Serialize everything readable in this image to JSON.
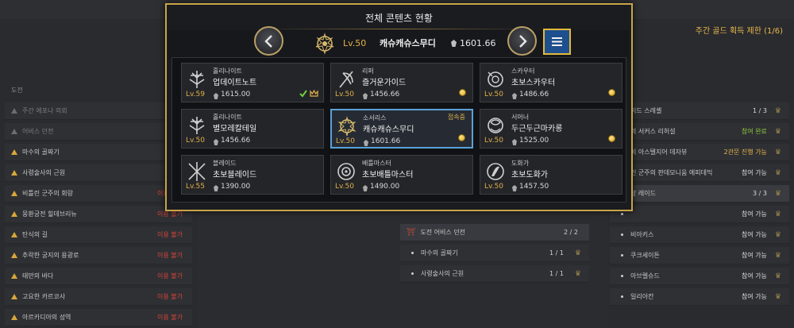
{
  "background": {
    "gold_limit": "주간 골드 획득 제한 (1/6)",
    "left_header": "도전",
    "left_rows": [
      {
        "name": "주간 에포나 의뢰",
        "status": ""
      },
      {
        "name": "어비스 던전",
        "status": ""
      },
      {
        "name": "마수의 골짜기",
        "status": "이용"
      },
      {
        "name": "사령술사의 근원",
        "status": "이용"
      },
      {
        "name": "비틀린 군주의 회랑",
        "status": "이용 불가"
      },
      {
        "name": "몽환궁전 힐데브리뉴",
        "status": "이용 불가"
      },
      {
        "name": "탄식의 길",
        "status": "이용 불가"
      },
      {
        "name": "추락한 궁지의 용광로",
        "status": "이용 불가"
      },
      {
        "name": "태만의 바다",
        "status": "이용 불가"
      },
      {
        "name": "고요한 카르코사",
        "status": "이용 불가"
      },
      {
        "name": "아르카디아의 성역",
        "status": "이용 불가"
      }
    ],
    "mid_rows": [
      {
        "name": "도전 어비스 던전",
        "count": "2 / 2"
      },
      {
        "name": "마수의 골짜기",
        "count": "1 / 1"
      },
      {
        "name": "사령술사의 근원",
        "count": "1 / 1"
      }
    ],
    "right_rows": [
      {
        "name": "이드 스레셸",
        "status": "1 / 3",
        "tone": "wht"
      },
      {
        "name": "의 서커스 리허설",
        "status": "참여 완료",
        "tone": "grn"
      },
      {
        "name": "비 아스텔지어 데자뷰",
        "status": "2관문 진행 가능",
        "tone": "yel"
      },
      {
        "name": "린 군주의 판데모니움 에피데믹",
        "status": "참여 가능",
        "tone": "wht"
      },
      {
        "name": "장 레이드",
        "status": "3 / 3",
        "tone": "wht"
      },
      {
        "name": "",
        "status": "참여 가능",
        "tone": "wht"
      },
      {
        "name": "비아키스",
        "status": "참여 가능",
        "tone": "wht"
      },
      {
        "name": "쿠크세이튼",
        "status": "참여 가능",
        "tone": "wht"
      },
      {
        "name": "아브렐슈드",
        "status": "참여 가능",
        "tone": "wht"
      },
      {
        "name": "일리아칸",
        "status": "참여 가능",
        "tone": "wht"
      }
    ]
  },
  "modal": {
    "title": "전체 콘텐츠 현황",
    "selected": {
      "level": "Lv.50",
      "name": "캐슈캐슈스무디",
      "item_level": "1601.66",
      "icon": "sorceress-emblem-icon"
    },
    "prev_icon": "chevron-left-icon",
    "next_icon": "chevron-right-icon",
    "menu_icon": "menu-icon",
    "characters": [
      {
        "class": "홀리나이트",
        "name": "업데이트노트",
        "level": "Lv.59",
        "item_level": "1615.00",
        "status": "",
        "icon": "holy-knight-emblem-icon",
        "marks": [
          "check",
          "crown"
        ]
      },
      {
        "class": "리퍼",
        "name": "즐거운가이드",
        "level": "Lv.50",
        "item_level": "1456.66",
        "status": "",
        "icon": "reaper-emblem-icon",
        "marks": [
          "coin"
        ]
      },
      {
        "class": "스카우터",
        "name": "초보스카우터",
        "level": "Lv.50",
        "item_level": "1486.66",
        "status": "",
        "icon": "scouter-emblem-icon",
        "marks": [
          "coin"
        ]
      },
      {
        "class": "홀리나이트",
        "name": "별모레칼테일",
        "level": "Lv.50",
        "item_level": "1456.66",
        "status": "",
        "icon": "holy-knight-emblem-icon",
        "marks": []
      },
      {
        "class": "소서리스",
        "name": "캐슈캐슈스무디",
        "level": "Lv.50",
        "item_level": "1601.66",
        "status": "접속중",
        "icon": "sorceress-emblem-icon",
        "marks": [
          "coin"
        ]
      },
      {
        "class": "서머너",
        "name": "두근두근마카롱",
        "level": "Lv.50",
        "item_level": "1525.00",
        "status": "",
        "icon": "summoner-emblem-icon",
        "marks": [
          "coin"
        ]
      },
      {
        "class": "블레이드",
        "name": "초보블레이드",
        "level": "Lv.55",
        "item_level": "1390.00",
        "status": "",
        "icon": "blade-emblem-icon",
        "marks": []
      },
      {
        "class": "배틀마스터",
        "name": "초보배틀마스터",
        "level": "Lv.50",
        "item_level": "1490.00",
        "status": "",
        "icon": "battle-master-emblem-icon",
        "marks": []
      },
      {
        "class": "도화가",
        "name": "초보도화가",
        "level": "Lv.50",
        "item_level": "1457.50",
        "status": "",
        "icon": "artist-emblem-icon",
        "marks": []
      }
    ]
  },
  "colors": {
    "accent_gold": "#c8a54a",
    "active_blue": "#5aa1d8",
    "level_gold": "#e0b04a",
    "menu_blue": "#1e4f8e"
  }
}
